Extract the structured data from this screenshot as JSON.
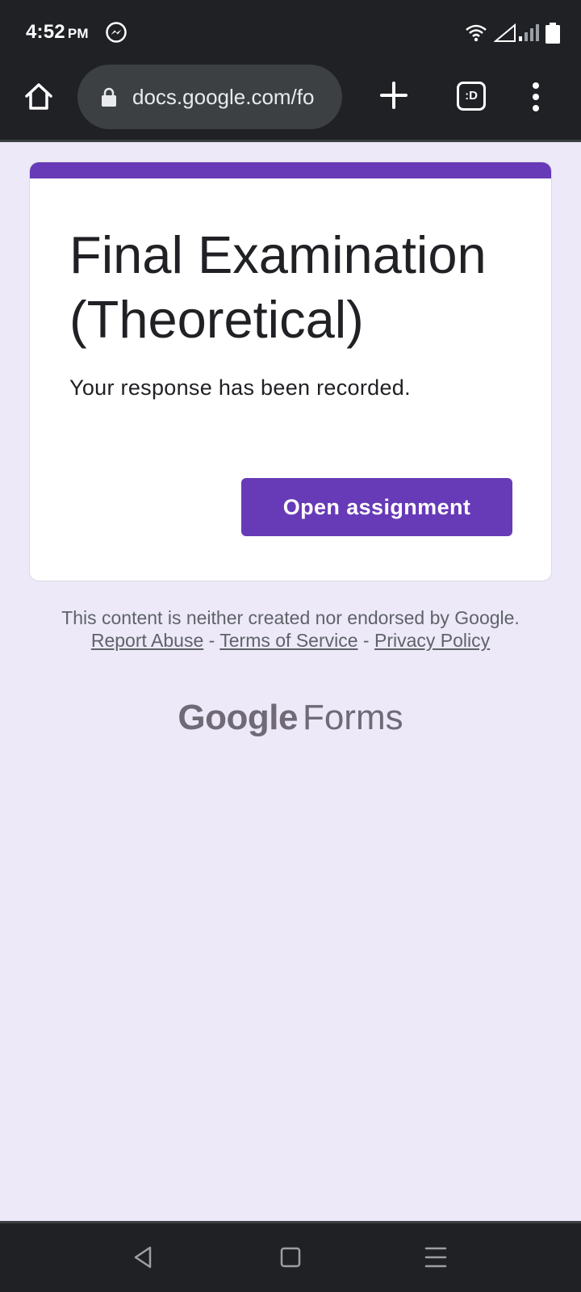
{
  "status_bar": {
    "time": "4:52",
    "ampm": "PM"
  },
  "browser": {
    "url": "docs.google.com/fo",
    "tabs_label": ":D"
  },
  "form": {
    "title": "Final Examination (Theoretical)",
    "message": "Your response has been recorded.",
    "open_button_label": "Open assignment"
  },
  "footer": {
    "disclaimer_text": "This content is neither created nor endorsed by Google.",
    "report_abuse": "Report Abuse",
    "separator": " - ",
    "terms": "Terms of Service",
    "privacy": "Privacy Policy",
    "logo_google": "Google",
    "logo_forms": "Forms"
  },
  "colors": {
    "accent": "#673ab7",
    "page_background": "#ede9f9",
    "chrome": "#202124"
  },
  "icons": [
    "messenger-icon",
    "wifi-icon",
    "signal-icon",
    "battery-icon",
    "home-icon",
    "lock-icon",
    "plus-icon",
    "tabs-icon",
    "more-vert-icon",
    "back-icon",
    "home-nav-icon",
    "recents-icon"
  ]
}
